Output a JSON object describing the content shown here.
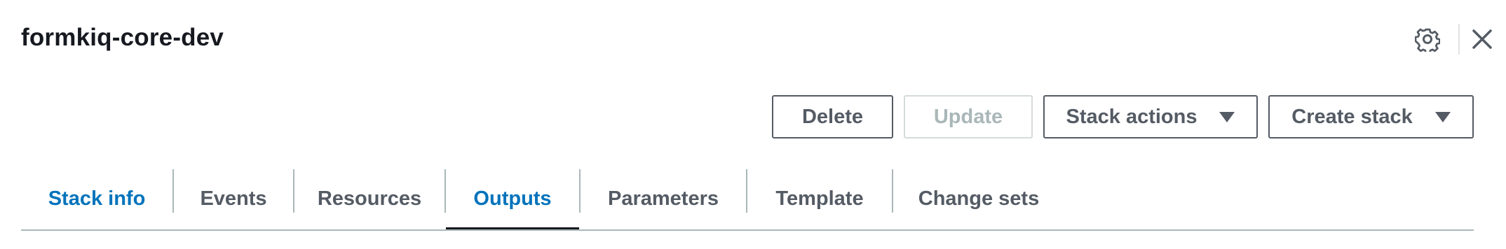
{
  "stack": {
    "name": "formkiq-core-dev"
  },
  "header": {
    "settings_icon": "gear-icon",
    "close_icon": "close-icon"
  },
  "actions": {
    "delete_label": "Delete",
    "update_label": "Update",
    "stack_actions_label": "Stack actions",
    "create_stack_label": "Create stack"
  },
  "tabs": [
    {
      "label": "Stack info"
    },
    {
      "label": "Events"
    },
    {
      "label": "Resources"
    },
    {
      "label": "Outputs",
      "selected": true
    },
    {
      "label": "Parameters"
    },
    {
      "label": "Template"
    },
    {
      "label": "Change sets"
    }
  ],
  "colors": {
    "link_blue": "#0073bb",
    "text_dark": "#16191f",
    "button_border": "#545b64",
    "disabled_text": "#aab7b8"
  }
}
